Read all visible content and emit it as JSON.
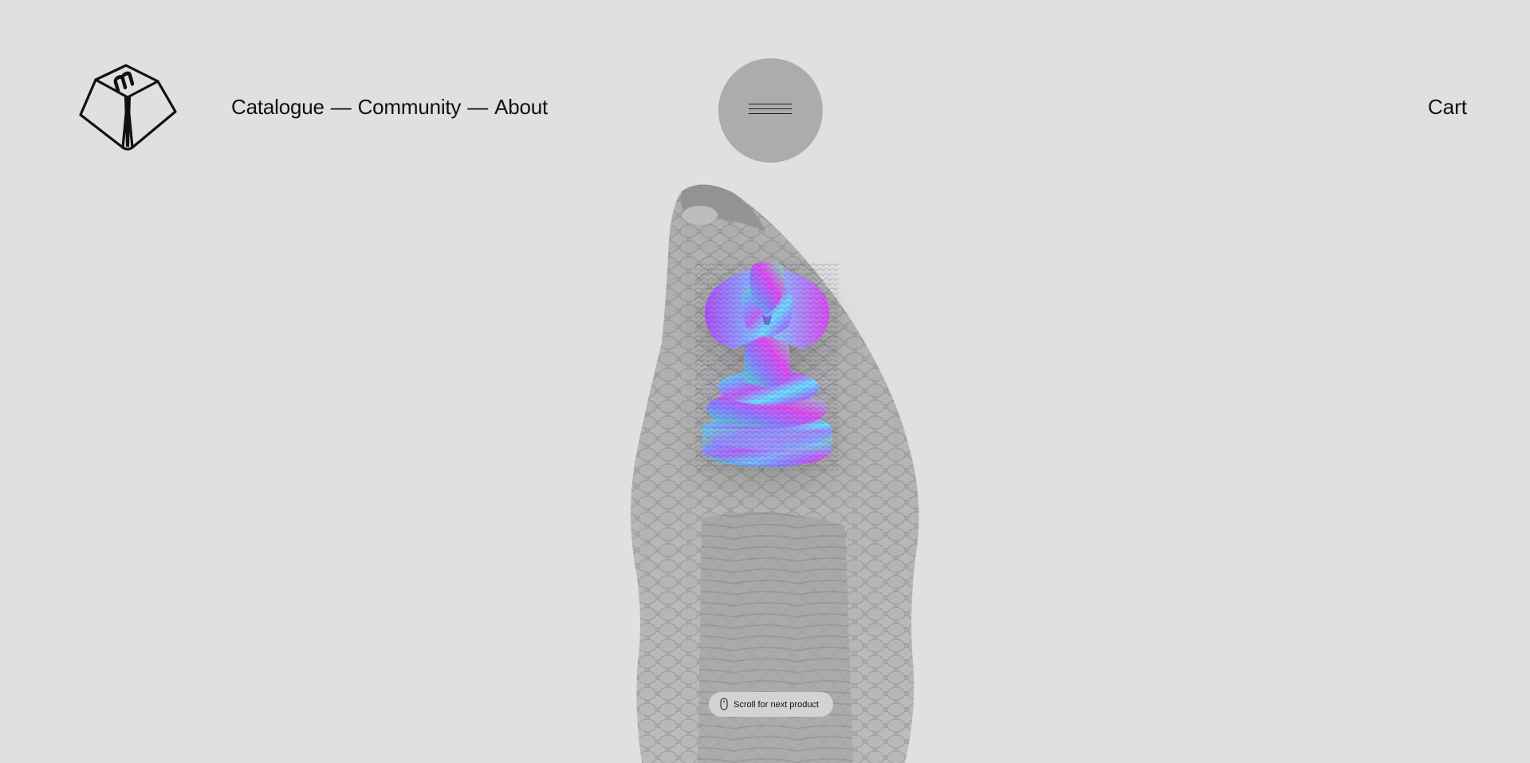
{
  "header": {
    "logo_name": "keycap-m-logo",
    "nav": [
      {
        "label": "Catalogue"
      },
      {
        "label": "Community"
      },
      {
        "label": "About"
      }
    ],
    "nav_separator": "—",
    "menu_icon": "hamburger-icon",
    "cart_label": "Cart"
  },
  "hero": {
    "background_image": "cobra-photo-grayscale",
    "product_image": "cobra-keycap-iridescent"
  },
  "scroll_hint": {
    "icon": "mouse-scroll-icon",
    "text": "Scroll for next product"
  },
  "colors": {
    "background": "#e0e0e0",
    "menu_button": "#acacac",
    "pill": "#d3d3d3",
    "text": "#111111"
  }
}
